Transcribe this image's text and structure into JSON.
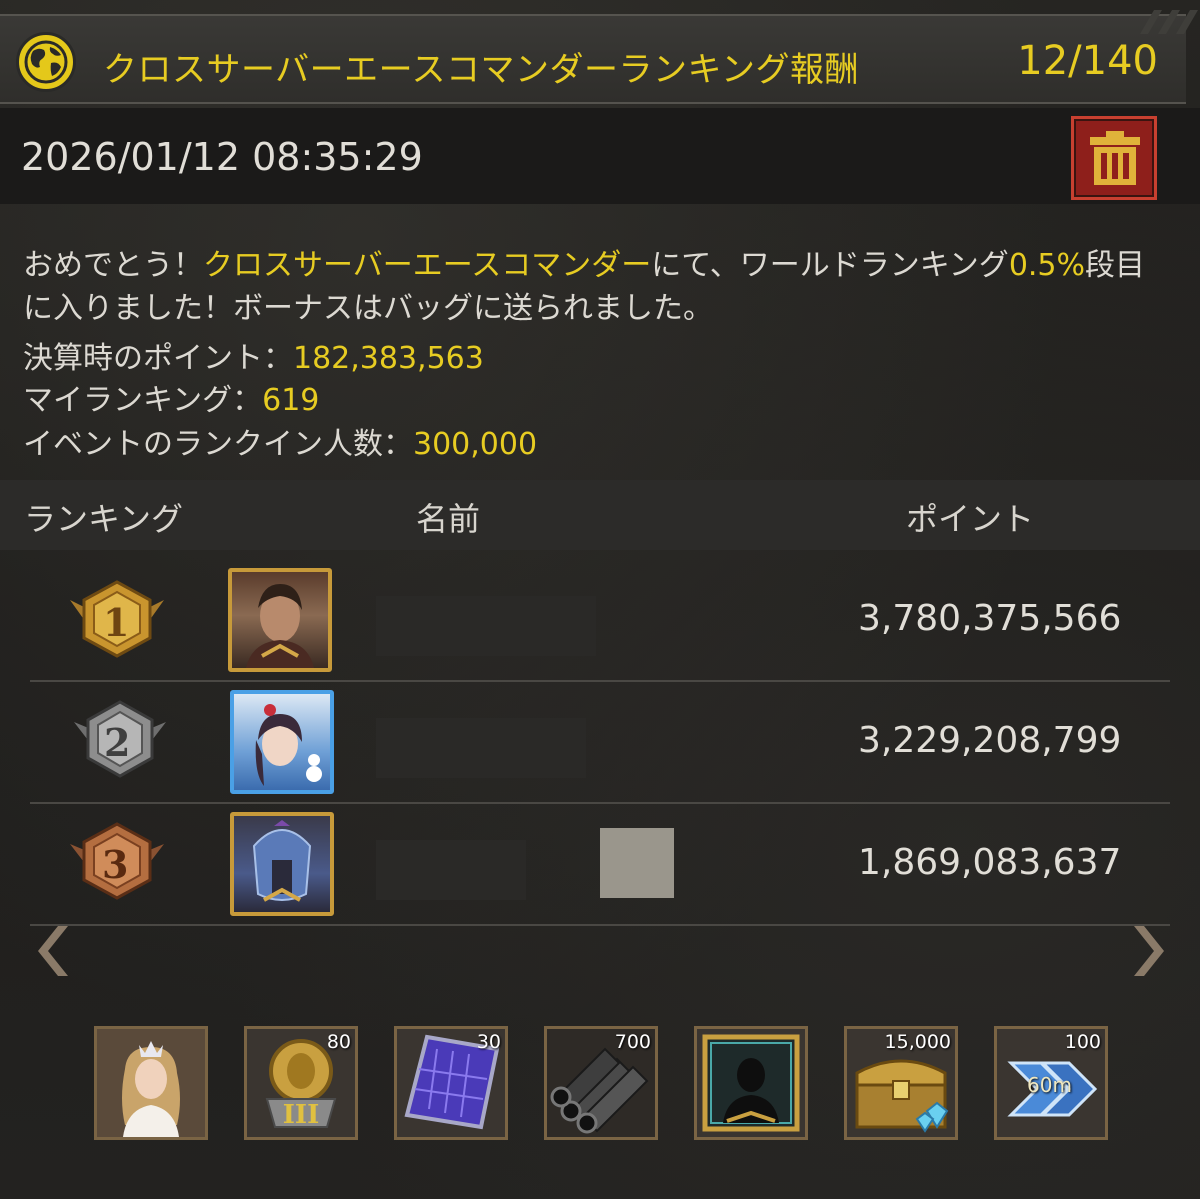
{
  "header": {
    "title": "クロスサーバーエースコマンダーランキング報酬",
    "counter": "12/140"
  },
  "mail": {
    "timestamp": "2026/01/12 08:35:29",
    "message_prefix": "おめでとう！",
    "message_event": "クロスサーバーエースコマンダー",
    "message_middle": "にて、ワールドランキング",
    "message_percent": "0.5%",
    "message_suffix": "段目に入りました！ボーナスはバッグに送られました。",
    "points_label": "決算時のポイント：",
    "points_value": "182,383,563",
    "rank_label": "マイランキング：",
    "rank_value": "619",
    "participants_label": "イベントのランクイン人数：",
    "participants_value": "300,000"
  },
  "table": {
    "col_rank": "ランキング",
    "col_name": "名前",
    "col_points": "ポイント",
    "rows": [
      {
        "rank": "1",
        "points": "3,780,375,566"
      },
      {
        "rank": "2",
        "points": "3,229,208,799"
      },
      {
        "rank": "3",
        "points": "1,869,083,637"
      }
    ]
  },
  "rewards": [
    {
      "icon": "commander-portrait-icon",
      "qty": ""
    },
    {
      "icon": "gold-medal-badge-icon",
      "qty": "80"
    },
    {
      "icon": "blueprint-icon",
      "qty": "30"
    },
    {
      "icon": "steel-pipes-icon",
      "qty": "700"
    },
    {
      "icon": "portrait-frame-icon",
      "qty": ""
    },
    {
      "icon": "treasure-chest-icon",
      "qty": "15,000"
    },
    {
      "icon": "speedup-icon",
      "qty": "100",
      "label": "60m"
    }
  ],
  "colors": {
    "accent": "#e7cc22",
    "delete": "#8e1f1b"
  }
}
